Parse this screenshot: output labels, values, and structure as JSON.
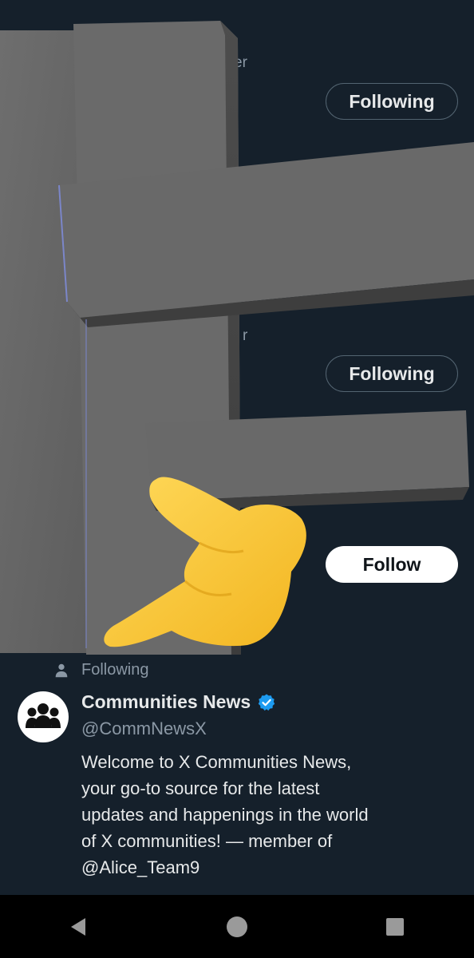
{
  "follow_list": {
    "rows": [
      {
        "sub_fragment": "er",
        "button_label": "Following",
        "state": "following"
      },
      {
        "sub_fragment": "r",
        "button_label": "Following",
        "state": "following"
      },
      {
        "sub_fragment": "",
        "button_label": "Follow",
        "state": "follow"
      }
    ]
  },
  "card": {
    "social_context": "Following",
    "name": "Communities News",
    "handle": "@CommNewsX",
    "bio": "Welcome to X Communities News,\nyour go-to source for the latest\nupdates and happenings in the world\nof X communities! — member of\n@Alice_Team9",
    "avatar_icon": "group-people-icon",
    "verified_icon": "verified-badge-icon"
  },
  "navbar": {
    "back_icon": "back-triangle-icon",
    "home_icon": "home-circle-icon",
    "recents_icon": "recents-square-icon"
  },
  "colors": {
    "background": "#15202b",
    "verified": "#1d9bf0",
    "muted_text": "#8b98a5"
  }
}
